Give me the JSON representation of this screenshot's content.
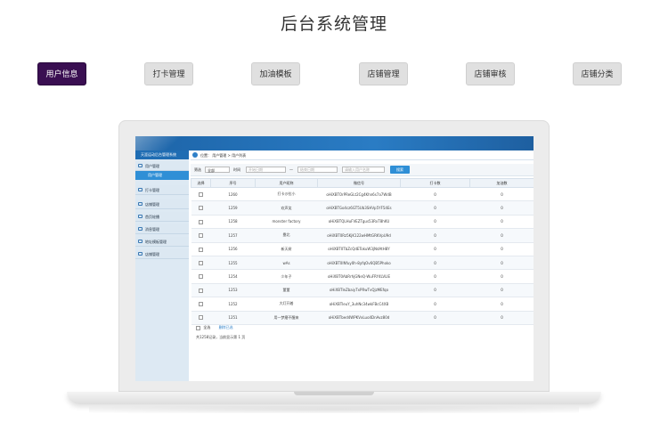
{
  "page": {
    "title": "后台系统管理"
  },
  "tabs": [
    {
      "label": "用户信息",
      "active": true
    },
    {
      "label": "打卡管理",
      "active": false
    },
    {
      "label": "加油模板",
      "active": false
    },
    {
      "label": "店铺管理",
      "active": false
    },
    {
      "label": "店铺审核",
      "active": false
    },
    {
      "label": "店铺分类",
      "active": false
    }
  ],
  "screen": {
    "brand": "天涯运动后台管理系统",
    "sidebar": [
      {
        "label": "用户管理",
        "icon": "user-icon"
      },
      {
        "label": "用户管理",
        "sub": true
      },
      {
        "label": "打卡管理",
        "icon": "user-icon"
      },
      {
        "label": "店铺管理",
        "icon": "store-icon"
      },
      {
        "label": "首页轮播",
        "icon": "image-icon"
      },
      {
        "label": "消息管理",
        "icon": "message-icon"
      },
      {
        "label": "地址模板管理",
        "icon": "map-icon"
      },
      {
        "label": "店铺管理",
        "icon": "store-icon"
      }
    ],
    "breadcrumb": "位置： 用户管理 > 用户列表",
    "filter": {
      "status_label": "筛选",
      "status_value": "全部",
      "time_label": "时间",
      "start_placeholder": "开始日期",
      "dash": "—",
      "end_placeholder": "结束日期",
      "keyword_placeholder": "请输入用户名称",
      "search_button": "搜索"
    },
    "table": {
      "headers": [
        "选择",
        "序号",
        "用户昵称",
        "微信号",
        "打卡数",
        "加油数"
      ],
      "rows": [
        [
          "1260",
          "打卡沙拉小",
          "oHiXBTOrPReGLt2Cg4Khn6s7a7WdB",
          "0",
          "0"
        ],
        [
          "1259",
          "欢声笑",
          "oHiXBTGo4cz6GT5Ub3SHVp5YF54Es",
          "0",
          "0"
        ],
        [
          "1258",
          "monster factory",
          "oHiXBTQLHuFVEZTgus53RxT8hKU",
          "0",
          "0"
        ],
        [
          "1257",
          "靠北",
          "oHiXBT0Rz5KjK122wHMtGRKVpU9d",
          "0",
          "0"
        ],
        [
          "1256",
          "新天树",
          "oHiXBT0TbZcQdETokuW3jNdAtH8Y",
          "0",
          "0"
        ],
        [
          "1255",
          "wAs",
          "oHiXBT0lNfuy0h-8yfqOv6QB5Phoko",
          "0",
          "0"
        ],
        [
          "1254",
          "少年子",
          "oHiXBT0AbRrhjGNeQ-WuFRY4LVLIE",
          "0",
          "0"
        ],
        [
          "1253",
          "董董",
          "oHiXBTleZbaiyTxPRwTvQjzMEfqo",
          "0",
          "0"
        ],
        [
          "1252",
          "大灯开着",
          "oHiXBTleuY_3uhNc34wkFBcC4XB",
          "0",
          "0"
        ],
        [
          "1251",
          "用一梦磨不醒来",
          "oHiXBTbed4WPKVxLuo4DnAvz80d",
          "0",
          "0"
        ]
      ]
    },
    "footer": {
      "select_all": "全选",
      "bulk_delete": "删除已选"
    },
    "pager": "共1258记录，当前显示第 1 页"
  }
}
